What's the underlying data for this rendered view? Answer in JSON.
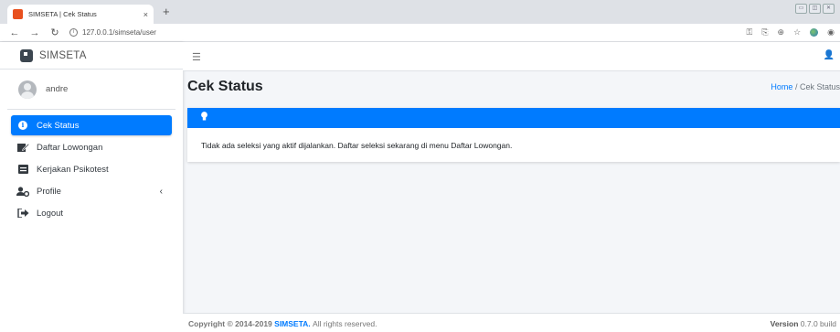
{
  "browser": {
    "tab_title": "SIMSETA | Cek Status",
    "tab_close": "×",
    "new_tab": "+",
    "url": "127.0.0.1/simseta/user"
  },
  "brand": {
    "name": "SIMSETA"
  },
  "user": {
    "name": "andre"
  },
  "sidebar": {
    "items": [
      {
        "label": "Cek Status",
        "icon": "info-circle-icon",
        "active": true
      },
      {
        "label": "Daftar Lowongan",
        "icon": "edit-icon"
      },
      {
        "label": "Kerjakan Psikotest",
        "icon": "id-card-icon"
      },
      {
        "label": "Profile",
        "icon": "users-cog-icon",
        "chevron": "‹"
      },
      {
        "label": "Logout",
        "icon": "sign-out-icon"
      }
    ]
  },
  "page": {
    "title": "Cek Status",
    "breadcrumb": {
      "home": "Home",
      "separator": "/",
      "current": "Cek Status"
    }
  },
  "alert": {
    "message": "Tidak ada seleksi yang aktif dijalankan. Daftar seleksi sekarang di menu Daftar Lowongan."
  },
  "footer": {
    "copyright_prefix": "Copyright © 2014-2019",
    "brand": "SIMSETA.",
    "rights": "All rights reserved.",
    "version_label": "Version",
    "version_value": "0.7.0 build"
  },
  "colors": {
    "primary": "#007bff",
    "sidebar_text": "#343a40",
    "background": "#f4f6f9"
  }
}
